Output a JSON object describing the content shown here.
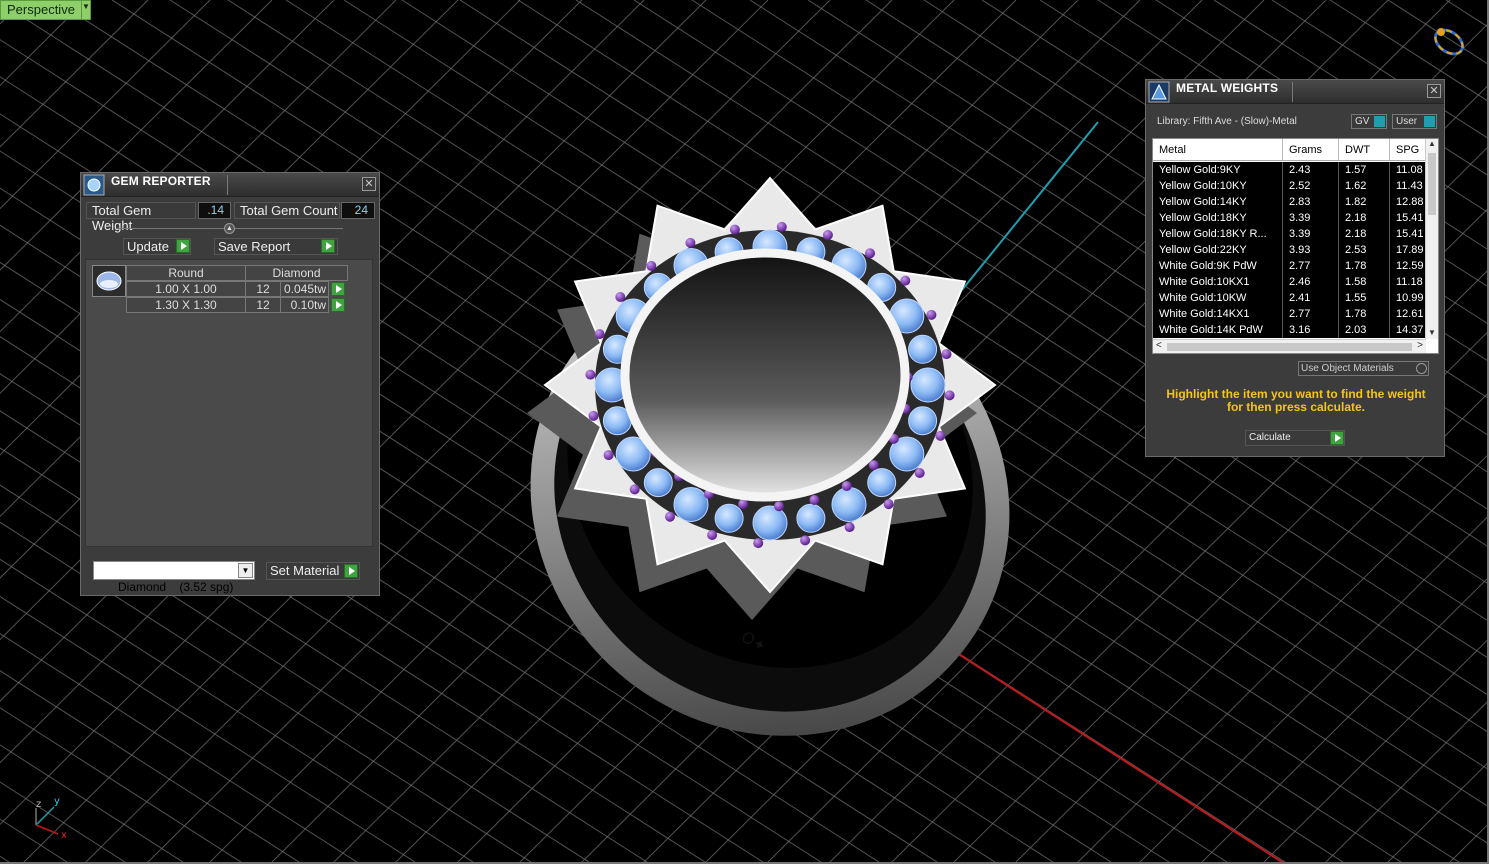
{
  "viewport": {
    "label": "Perspective",
    "axes": {
      "z": "z",
      "y": "y",
      "x": "x"
    }
  },
  "gem_reporter": {
    "title": "GEM REPORTER",
    "total_weight_label": "Total Gem Weight",
    "total_weight_value": ".14",
    "total_count_label": "Total Gem Count",
    "total_count_value": "24",
    "update_label": "Update",
    "save_report_label": "Save Report",
    "headers": {
      "shape": "Round",
      "material": "Diamond"
    },
    "rows": [
      {
        "size": "1.00 X 1.00",
        "count": "12",
        "weight": "0.045tw"
      },
      {
        "size": "1.30 X 1.30",
        "count": "12",
        "weight": "0.10tw"
      }
    ],
    "material_select": "Diamond    (3.52 spg)",
    "set_material_label": "Set Material"
  },
  "metal_weights": {
    "title": "METAL WEIGHTS",
    "library": "Library: Fifth Ave - (Slow)-Metal",
    "gv_label": "GV",
    "user_label": "User",
    "columns": [
      "Metal",
      "Grams",
      "DWT",
      "SPG"
    ],
    "rows": [
      [
        "Yellow Gold:9KY",
        "2.43",
        "1.57",
        "11.08"
      ],
      [
        "Yellow Gold:10KY",
        "2.52",
        "1.62",
        "11.43"
      ],
      [
        "Yellow Gold:14KY",
        "2.83",
        "1.82",
        "12.88"
      ],
      [
        "Yellow Gold:18KY",
        "3.39",
        "2.18",
        "15.41"
      ],
      [
        "Yellow Gold:18KY R...",
        "3.39",
        "2.18",
        "15.41"
      ],
      [
        "Yellow Gold:22KY",
        "3.93",
        "2.53",
        "17.89"
      ],
      [
        "White Gold:9K PdW",
        "2.77",
        "1.78",
        "12.59"
      ],
      [
        "White Gold:10KX1",
        "2.46",
        "1.58",
        "11.18"
      ],
      [
        "White Gold:10KW",
        "2.41",
        "1.55",
        "10.99"
      ],
      [
        "White Gold:14KX1",
        "2.77",
        "1.78",
        "12.61"
      ],
      [
        "White Gold:14K PdW",
        "3.16",
        "2.03",
        "14.37"
      ]
    ],
    "use_object_materials": "Use Object Materials",
    "hint": "Highlight the item you want to find the weight for then press calculate.",
    "calculate_label": "Calculate"
  },
  "colors": {
    "accent_green": "#3fa43f",
    "hint_yellow": "#f5c518",
    "grid": "#6f6f6f",
    "axis_red": "#c0181a",
    "axis_cyan": "#1e9fb0",
    "gem_blue": "#8cbaf5",
    "prong_purple": "#7a2fb0"
  }
}
